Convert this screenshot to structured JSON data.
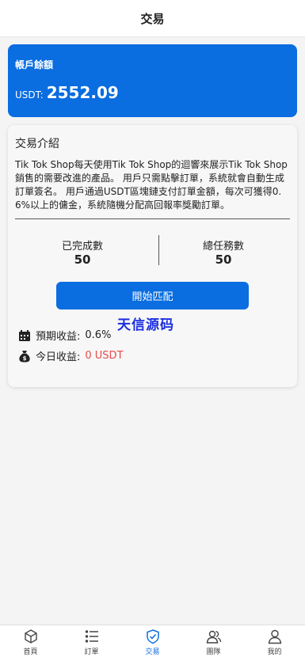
{
  "header": {
    "title": "交易"
  },
  "balance": {
    "label": "帳戶餘額",
    "currency": "USDT:",
    "amount": "2552.09"
  },
  "intro": {
    "title": "交易介紹",
    "text": "Tik Tok Shop每天使用Tik Tok Shop的迴響來展示Tik Tok Shop銷售的需要改進的產品。 用戶只需點擊訂單，系統就會自動生成訂單簽名。 用戶通過USDT區塊鏈支付訂單金額，每次可獲得0.6%以上的傭金，系統隨機分配高回報率獎勵訂單。"
  },
  "stats": {
    "completed_label": "已完成數",
    "completed_value": "50",
    "total_label": "總任務數",
    "total_value": "50"
  },
  "match_button": "開始匹配",
  "watermark": "天信源码",
  "expected": {
    "label": "預期收益:",
    "value": "0.6%"
  },
  "today": {
    "label": "今日收益:",
    "value": "0 USDT"
  },
  "nav": [
    {
      "label": "首頁",
      "icon": "home-icon"
    },
    {
      "label": "訂單",
      "icon": "list-icon"
    },
    {
      "label": "交易",
      "icon": "shield-check-icon",
      "active": true
    },
    {
      "label": "團隊",
      "icon": "team-icon"
    },
    {
      "label": "我的",
      "icon": "user-icon"
    }
  ],
  "colors": {
    "primary": "#0a6de0",
    "red": "#e84a4a",
    "watermark": "#1a2ee0"
  }
}
